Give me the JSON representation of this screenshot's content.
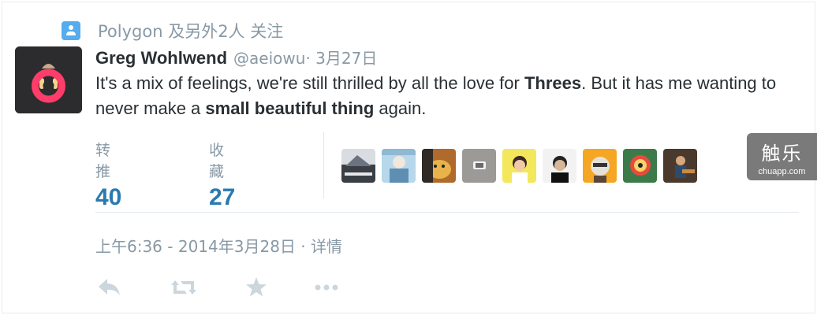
{
  "context": {
    "icon": "person-icon",
    "text": "Polygon 及另外2人 关注"
  },
  "tweet": {
    "name": "Greg Wohlwend",
    "handle": "@aeiowu",
    "date": " · 3月27日",
    "text_parts": {
      "p1": "It's a mix of feelings, we're still thrilled by all the love for ",
      "b1": "Threes",
      "p2": ". But it has me wanting to never make a ",
      "b2": "small beautiful thing",
      "p3": " again."
    }
  },
  "stats": {
    "retweets_label": "转推",
    "retweets_value": "40",
    "favorites_label": "收藏",
    "favorites_value": "27"
  },
  "favoriters": [
    {
      "name": "favoriter-1"
    },
    {
      "name": "favoriter-2"
    },
    {
      "name": "favoriter-3"
    },
    {
      "name": "favoriter-4"
    },
    {
      "name": "favoriter-5"
    },
    {
      "name": "favoriter-6"
    },
    {
      "name": "favoriter-7"
    },
    {
      "name": "favoriter-8"
    },
    {
      "name": "favoriter-9"
    }
  ],
  "watermark": {
    "title": "触乐",
    "sub": "chuapp.com"
  },
  "timestamp": "上午6:36 - 2014年3月28日 · 详情",
  "actions": {
    "reply_icon": "reply-icon",
    "retweet_icon": "retweet-icon",
    "favorite_icon": "star-icon",
    "more_icon": "more-icon"
  },
  "colors": {
    "accent": "#55acee",
    "stat_value": "#2a7ab0",
    "muted": "#8899a6",
    "text": "#292f33",
    "avatar_ring": "#ff3d6b"
  }
}
